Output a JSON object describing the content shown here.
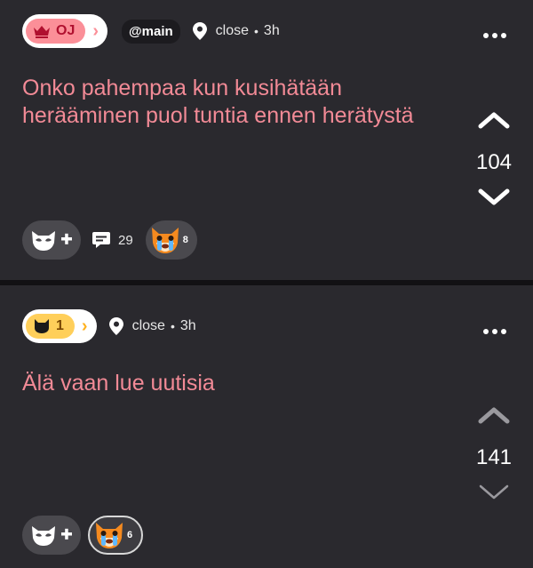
{
  "posts": [
    {
      "badge_label": "OJ",
      "badge_color": "#fb8f98",
      "badge_icon": "crown-icon",
      "channel": "@main",
      "location": "close",
      "separator": "•",
      "time": "3h",
      "text": "Onko pahempaa kun kusihätään herääminen puol tuntia ennen herätystä",
      "score": "104",
      "comments": "29",
      "reaction_icon": "crying-fox-emoji",
      "reaction_count": "8"
    },
    {
      "badge_label": "1",
      "badge_color": "#ffcf5a",
      "badge_icon": "cat-icon",
      "location": "close",
      "separator": "•",
      "time": "3h",
      "text": "Älä vaan lue uutisia",
      "score": "141",
      "reaction_icon": "crying-fox-emoji",
      "reaction_count": "6"
    }
  ],
  "icons": {
    "menu": "more-dots-icon",
    "location": "location-pin-icon",
    "upvote": "chevron-up-icon",
    "downvote": "chevron-down-icon",
    "add_reaction": "add-reaction-icon",
    "comment": "comment-icon"
  }
}
